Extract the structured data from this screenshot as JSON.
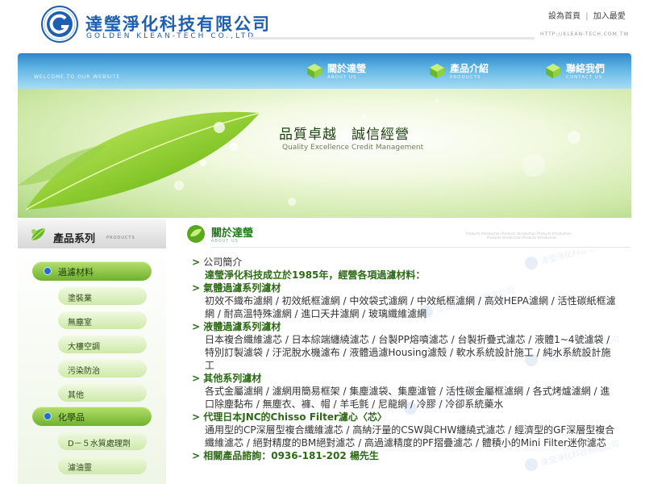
{
  "header": {
    "logo_cn": "達瑩淨化科技有限公司",
    "logo_en": "GOLDEN KLEAN-TECH CO.,LTD.",
    "logo_ring_text": "GOLDEN KLEAN-TECH",
    "url": "HTTP://KLEAN-TECH.COM.TW",
    "set_home": "設為首頁",
    "add_fav": "加入最愛",
    "separator": "|"
  },
  "nav": {
    "welcome": "WELCOME TO OUR WEBSITE",
    "items": [
      {
        "cn": "關於達瑩",
        "en": "ABOUT US"
      },
      {
        "cn": "產品介紹",
        "en": "PRODUCTS"
      },
      {
        "cn": "聯絡我們",
        "en": "CONTACT US"
      }
    ]
  },
  "banner": {
    "slogan_cn": "品質卓越　誠信經營",
    "slogan_en": "Quality Excellence Credit Management"
  },
  "sidebar": {
    "title": "產品系列",
    "title_en": "PRODUCTS",
    "categories": [
      {
        "label": "過濾材料",
        "subs": [
          "塗裝業",
          "無塵室",
          "大樓空調",
          "污染防治",
          "其他"
        ]
      },
      {
        "label": "化學品",
        "subs": [
          "D－５水質處理劑",
          "濾油靈"
        ]
      }
    ]
  },
  "content": {
    "title": "關於達瑩",
    "title_en": "ABOUT US",
    "deco_line1": "Products Introduction Products Introduction Products Introduction",
    "deco_line2": "Products Introduction Products Introduction",
    "watermark": "達瑩淨化科技有限公司",
    "arrow": ">",
    "sections": [
      {
        "heading": "公司簡介",
        "plain": true,
        "lines": [
          "達瑩淨化科技成立於1985年，經營各項過濾材料："
        ]
      },
      {
        "heading": "氣體過濾系列濾材",
        "lines": [
          "初效不織布濾網 / 初效紙框濾網 / 中效袋式濾網 / 中效紙框濾網 / 高效HEPA濾網 / 活性碳紙框濾網 / 耐高溫特殊濾網 / 進口天井濾網 / 玻璃纖維濾網"
        ]
      },
      {
        "heading": "液體過濾系列濾材",
        "lines": [
          "日本複合纖維濾芯 / 日本綜端纏繞濾芯 / 台製PP熔噴濾芯 / 台製折疊式濾芯 / 液體1~4號濾袋 / 特別訂製濾袋 / 汙泥脫水機濾布 / 液體過濾Housing濾殼 / 軟水系統設計施工 / 純水系統設計施工"
        ]
      },
      {
        "heading": "其他系列濾材",
        "lines": [
          "各式金屬濾網 / 濾網用簡易框架 / 集塵濾袋、集塵濾管 / 活性碳金屬框濾網 / 各式烤爐濾網 / 進口除塵黏布 / 無塵衣、褲、帽 / 羊毛氈 / 尼龍網 / 冷膠 / 冷卻系統藥水"
        ]
      },
      {
        "heading": "代理日本JNC的Chisso Filter濾心〈芯〉",
        "lines": [
          "通用型的CP深層型複合纖維濾芯 / 高納汙量的CSW與CHW纏繞式濾芯 / 經濟型的GF深層型複合纖維濾芯 / 絕對精度的BM絕對濾芯 / 高過濾精度的PF摺疊濾芯 / 體積小的Mini Filter迷你濾芯"
        ]
      },
      {
        "heading": "相關產品諮詢：0936-181-202 楊先生",
        "lines": []
      }
    ]
  },
  "colors": {
    "brand_blue": "#1f5fb0",
    "leaf_green": "#6fb12d",
    "heading_green": "#2c6a15",
    "nav_blue": "#2f86c9"
  }
}
